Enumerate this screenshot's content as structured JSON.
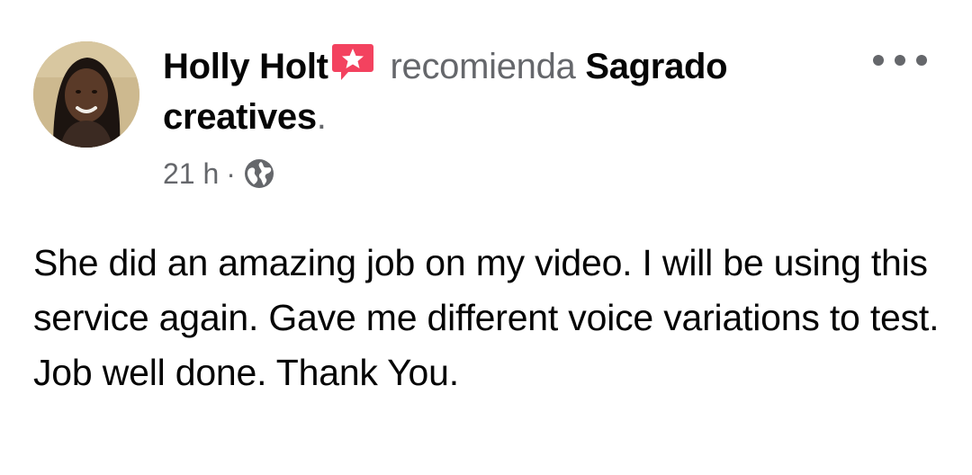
{
  "post": {
    "author": "Holly Holt",
    "action": "recomienda",
    "page": "Sagrado creatives",
    "punctuation": ".",
    "timestamp": "21 h",
    "separator": "·",
    "privacy_icon": "globe-icon",
    "recommendation_icon": "recommendation-star-icon",
    "more_icon": "more-options-icon",
    "body": "She did an amazing job on my video. I will be using this service again. Gave me different voice variations to test. Job well done.  Thank You."
  },
  "colors": {
    "primary_text": "#050505",
    "secondary_text": "#65676b",
    "recommend_badge": "#f3425f",
    "background": "#ffffff"
  }
}
